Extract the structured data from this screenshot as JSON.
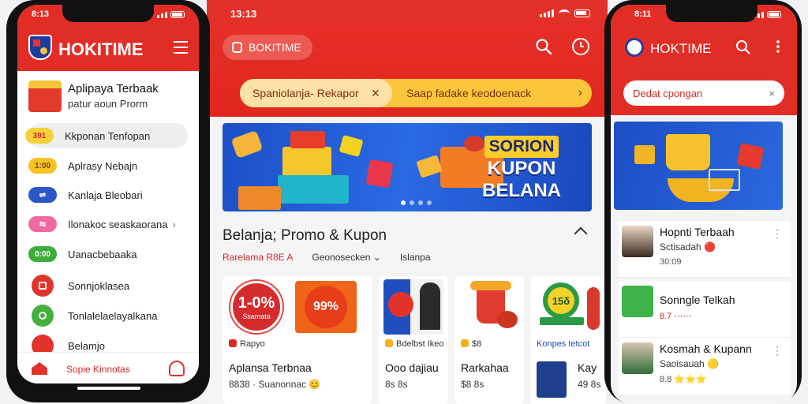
{
  "middle": {
    "status_time": "13:13",
    "app_pill_label": "BOKITIME",
    "filter": {
      "chip_label": "Spaniolanja- Rekapor",
      "chip_close": "×",
      "second_label": "Saap fadake keodoenack",
      "chevron": "›"
    },
    "banner": {
      "line1": "SORION",
      "line2": "KUPON",
      "line3": "BELANA"
    },
    "section_title": "Belanja; Promo & Kupon",
    "tabs": [
      "Rarelama R8E A",
      "Geonosecken ⌄",
      "Islanpa"
    ],
    "cards": [
      {
        "badge": "1-0%",
        "badge_sub": "Ssamata",
        "badge2": "99%",
        "meta": "Rapyo",
        "name": "Aplansa Terbnaa",
        "price": "8838 · Suanonnac 😊"
      },
      {
        "meta": "Bdelbst Ikeo",
        "name": "Ooo dajiau",
        "price": "8s 8s"
      },
      {
        "meta": "$8",
        "name": "Rarkahaa",
        "price": "$8 8s"
      },
      {
        "badge": "15δ",
        "meta": "Konpes tetcot",
        "name": "Kay",
        "price": "49 8s"
      }
    ]
  },
  "left_phone": {
    "status_time": "8:13",
    "brand": "HOKITIME",
    "promo_title": "Aplipaya Terbaak",
    "promo_subtitle": "patur aoun Prorm",
    "menu": [
      {
        "badge": "391",
        "label": "Kkponan Tenfopan"
      },
      {
        "badge": "1:00",
        "label": "Aplrasy Nebajn"
      },
      {
        "badge": "⇌",
        "label": "Kanlaja Bleobari"
      },
      {
        "badge": "⇆",
        "label": "Ilonakoc seaskaorana"
      },
      {
        "badge": "0:00",
        "label": "Uanacbebaaka"
      },
      {
        "badge": "",
        "label": "Sonnjoklasea"
      },
      {
        "badge": "",
        "label": "Tonlalelaelayalkana"
      },
      {
        "badge": "",
        "label": "Belamjo"
      }
    ],
    "bottom_label": "Sopie Kinnotas"
  },
  "right_phone": {
    "status_time": "8:11",
    "brand": "HOKTIME",
    "search_label": "Dedat cpongan",
    "items": [
      {
        "title": "Hopnti Terbaah",
        "sub": "Sctisadah 🔴",
        "meta": "30:09"
      },
      {
        "title": "Sonngle Telkah",
        "sub": "",
        "meta": "8.7 ⋯⋯"
      },
      {
        "title": "Kosmah & Kupann",
        "sub": "Saoisauah 🟡",
        "meta": "8.8 ⭐⭐⭐"
      }
    ]
  },
  "colors": {
    "brand_red": "#e22d26",
    "yellow": "#fbc63b",
    "blue": "#1d4fc7"
  }
}
